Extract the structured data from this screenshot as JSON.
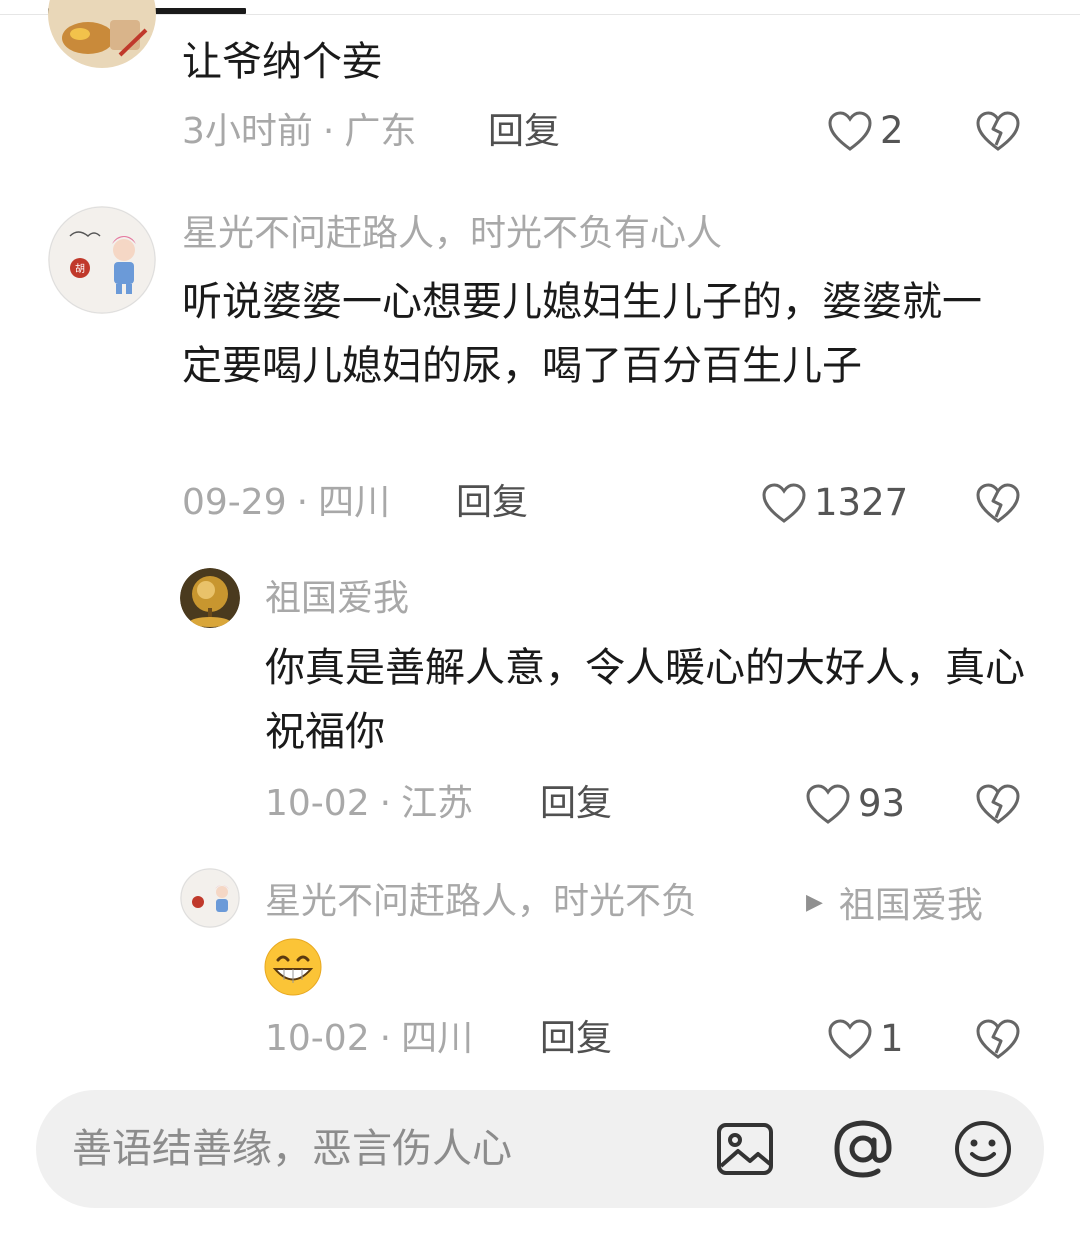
{
  "comments": [
    {
      "text": "让爷纳个妾",
      "time": "3小时前",
      "location": "广东",
      "reply_label": "回复",
      "likes": "2"
    },
    {
      "username": "星光不问赶路人，时光不负有心人",
      "text": "听说婆婆一心想要儿媳妇生儿子的，婆婆就一定要喝儿媳妇的尿，喝了百分百生儿子",
      "time": "09-29",
      "location": "四川",
      "reply_label": "回复",
      "likes": "1327"
    },
    {
      "username": "祖国爱我",
      "text": "你真是善解人意，令人暖心的大好人，真心祝福你",
      "time": "10-02",
      "location": "江苏",
      "reply_label": "回复",
      "likes": "93"
    },
    {
      "username": "星光不问赶路人，时光不负",
      "reply_to": "祖国爱我",
      "emoji": "grinning-face",
      "time": "10-02",
      "location": "四川",
      "reply_label": "回复",
      "likes": "1"
    }
  ],
  "composer": {
    "placeholder": "善语结善缘，恶言伤人心",
    "icons": [
      "image-icon",
      "at-icon",
      "emoji-icon"
    ]
  },
  "colors": {
    "meta": "#a8a8a8",
    "text": "#1a1a1a",
    "composer_bg": "#f0f0f0"
  }
}
